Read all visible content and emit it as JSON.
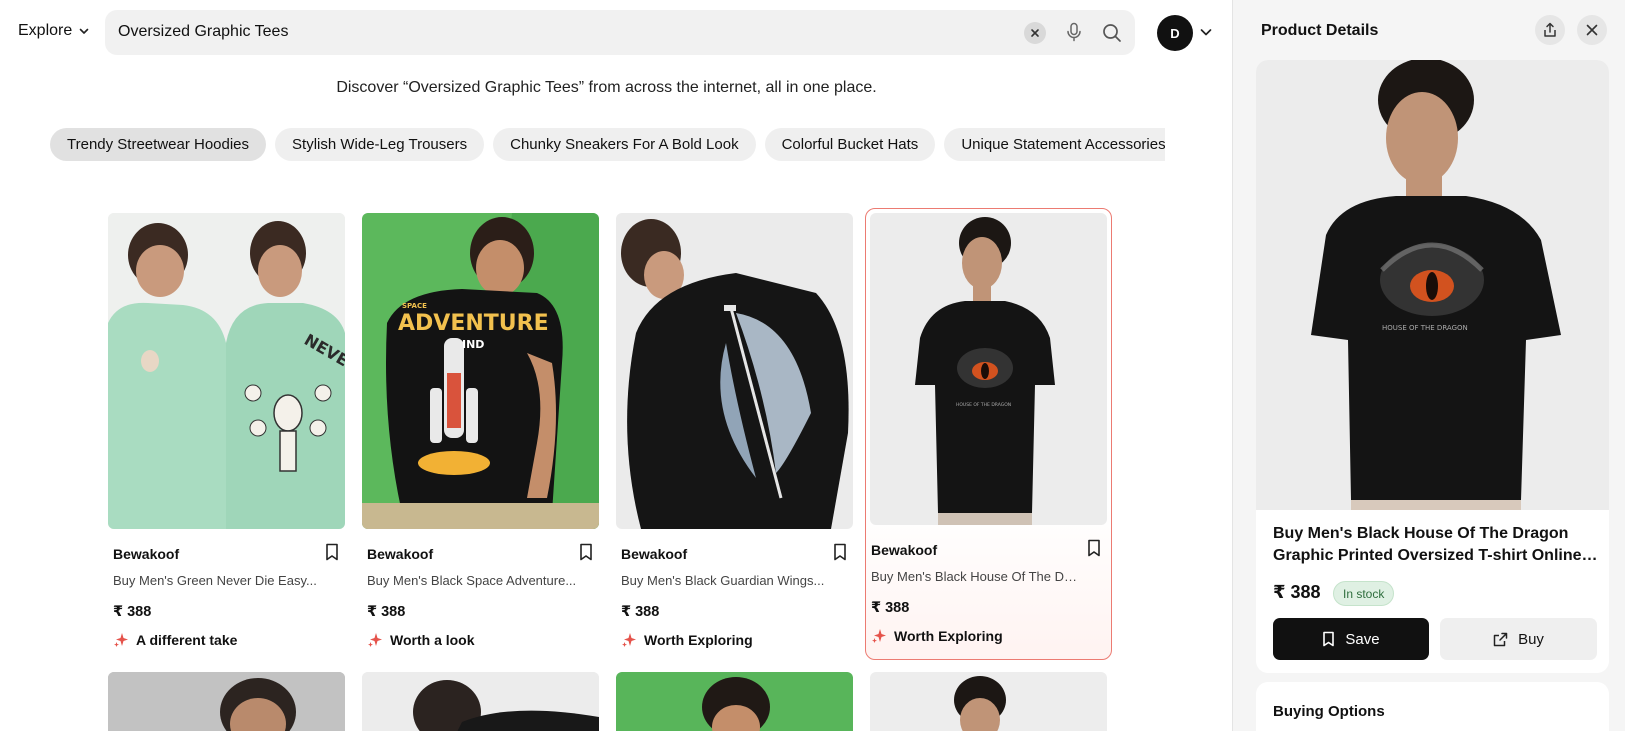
{
  "header": {
    "explore_label": "Explore",
    "search_value": "Oversized Graphic Tees",
    "avatar_initial": "D"
  },
  "discover_text": "Discover “Oversized Graphic Tees” from across the internet, all in one place.",
  "chips": [
    "Trendy Streetwear Hoodies",
    "Stylish Wide-Leg Trousers",
    "Chunky Sneakers For A Bold Look",
    "Colorful Bucket Hats",
    "Unique Statement Accessories"
  ],
  "products": [
    {
      "brand": "Bewakoof",
      "title": "Buy Men's Green Never Die Easy...",
      "price": "₹ 388",
      "tag": "A different take",
      "image": "green-skeleton-tee"
    },
    {
      "brand": "Bewakoof",
      "title": "Buy Men's Black Space Adventure...",
      "price": "₹ 388",
      "tag": "Worth a look",
      "image": "black-space-rocket-tee"
    },
    {
      "brand": "Bewakoof",
      "title": "Buy Men's Black Guardian Wings...",
      "price": "₹ 388",
      "tag": "Worth Exploring",
      "image": "black-guardian-wings-tee"
    },
    {
      "brand": "Bewakoof",
      "title": "Buy Men's Black House Of The Drago...",
      "price": "₹ 388",
      "tag": "Worth Exploring",
      "image": "black-dragon-eye-tee"
    }
  ],
  "panel": {
    "title": "Product Details",
    "name_line1": "Buy Men's Black House Of The Dragon",
    "name_line2": "Graphic Printed Oversized T-shirt Online a...",
    "price": "₹ 388",
    "stock": "In stock",
    "save_label": "Save",
    "buy_label": "Buy",
    "buying_options_label": "Buying Options"
  },
  "colors": {
    "accent_selected_border": "#ec7b72",
    "stock_badge_bg": "#dff0e3",
    "tag_sparkle": "#e5534b"
  }
}
